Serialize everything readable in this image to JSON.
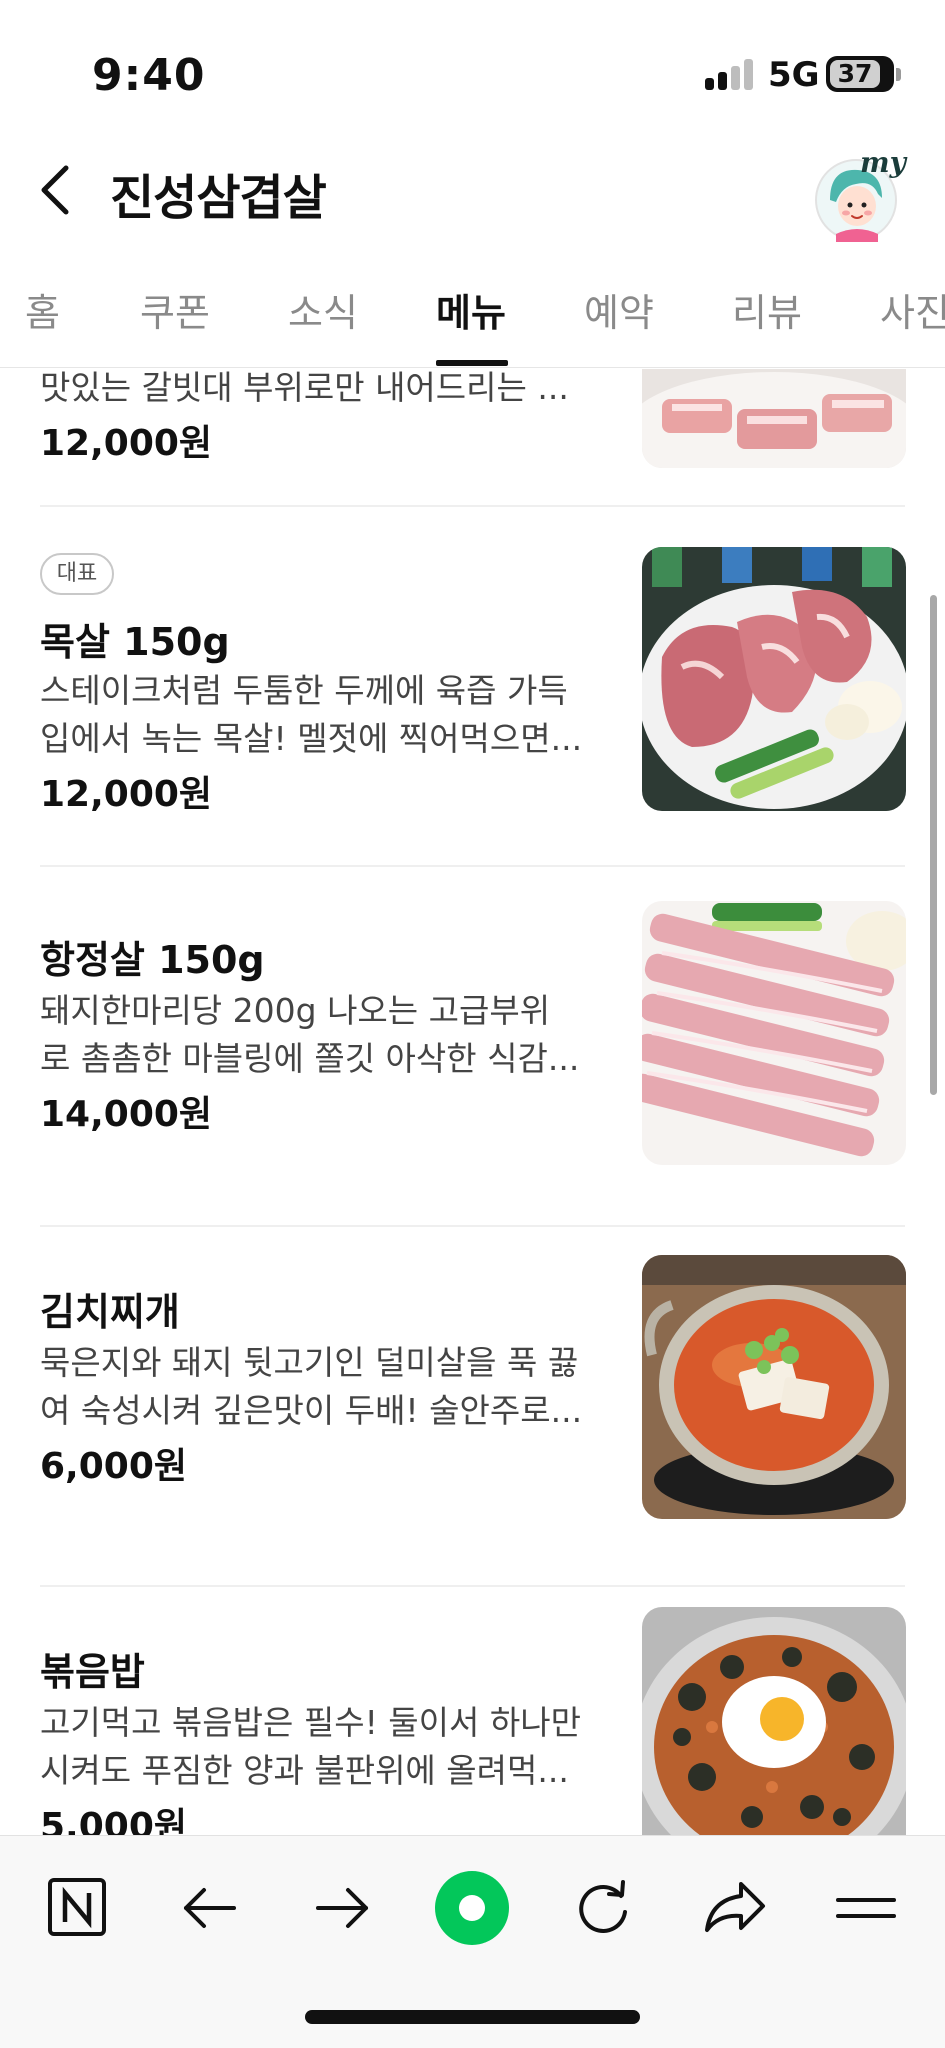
{
  "status_bar": {
    "time": "9:40",
    "network": "5G",
    "battery": "37"
  },
  "header": {
    "title": "진성삼겹살",
    "avatar_label": "my"
  },
  "tabs": [
    {
      "label": "홈",
      "active": false
    },
    {
      "label": "쿠폰",
      "active": false
    },
    {
      "label": "소식",
      "active": false
    },
    {
      "label": "메뉴",
      "active": true
    },
    {
      "label": "예약",
      "active": false
    },
    {
      "label": "리뷰",
      "active": false
    },
    {
      "label": "사진",
      "active": false
    }
  ],
  "menu_items": [
    {
      "badge": "",
      "name": "",
      "desc_lines": [
        "맛있는 갈빗대 부위로만 내어드리는 ..."
      ],
      "price": "12,000원",
      "image": "pork-belly-photo"
    },
    {
      "badge": "대표",
      "name": "목살 150g",
      "desc_lines": [
        "스테이크처럼 두툼한 두께에 육즙 가득",
        "입에서 녹는 목살! 멜젓에 찍어먹으면..."
      ],
      "price": "12,000원",
      "image": "pork-neck-photo"
    },
    {
      "badge": "",
      "name": "항정살 150g",
      "desc_lines": [
        "돼지한마리당 200g 나오는 고급부위",
        "로 촘촘한 마블링에 쫄깃 아삭한 식감..."
      ],
      "price": "14,000원",
      "image": "pork-jowl-photo"
    },
    {
      "badge": "",
      "name": "김치찌개",
      "desc_lines": [
        "묵은지와 돼지 뒷고기인 덜미살을 푹 끓",
        "여 숙성시켜 깊은맛이 두배! 술안주로..."
      ],
      "price": "6,000원",
      "image": "kimchi-stew-photo"
    },
    {
      "badge": "",
      "name": "볶음밥",
      "desc_lines": [
        "고기먹고 볶음밥은 필수! 둘이서 하나만",
        "시켜도 푸짐한 양과 불판위에 올려먹..."
      ],
      "price": "5,000원",
      "image": "fried-rice-photo"
    }
  ],
  "toolbar": {
    "items": [
      "naver-icon",
      "back-arrow-icon",
      "forward-arrow-icon",
      "green-circle-icon",
      "refresh-icon",
      "share-icon",
      "menu-icon"
    ]
  },
  "colors": {
    "accent_green": "#03c75a",
    "text_primary": "#111111",
    "text_muted": "#8a8a8a"
  }
}
